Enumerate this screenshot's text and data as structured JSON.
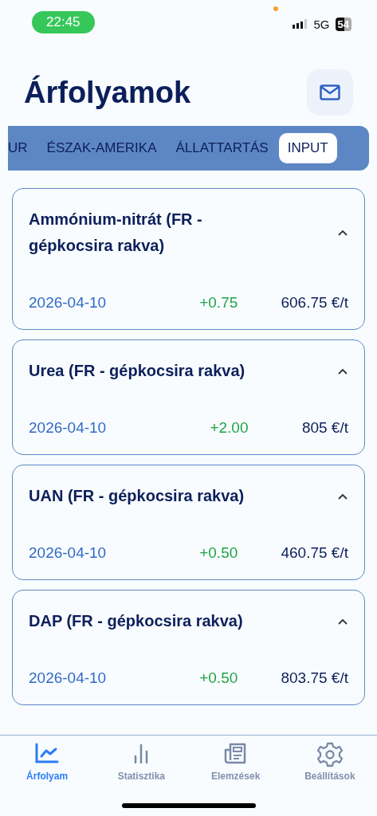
{
  "status_bar": {
    "time": "22:45",
    "network": "5G",
    "battery": "54"
  },
  "header": {
    "title": "Árfolyamok"
  },
  "tabs": [
    {
      "label": "UR",
      "selected": false
    },
    {
      "label": "ÉSZAK-AMERIKA",
      "selected": false
    },
    {
      "label": "ÁLLATTARTÁS",
      "selected": false
    },
    {
      "label": "INPUT",
      "selected": true
    }
  ],
  "prices": [
    {
      "name": "Ammónium-nitrát (FR - gépkocsira rakva)",
      "expanded": true,
      "date": "2026-04-10",
      "change": "+0.75",
      "price": "606.75 €/t"
    },
    {
      "name": "Urea (FR - gépkocsira rakva)",
      "expanded": true,
      "date": "2026-04-10",
      "change": "+2.00",
      "price": "805 €/t"
    },
    {
      "name": "UAN (FR - gépkocsira rakva)",
      "expanded": true,
      "date": "2026-04-10",
      "change": "+0.50",
      "price": "460.75 €/t"
    },
    {
      "name": "DAP (FR - gépkocsira rakva)",
      "expanded": true,
      "date": "2026-04-10",
      "change": "+0.50",
      "price": "803.75 €/t"
    }
  ],
  "bottom_nav": [
    {
      "label": "Árfolyam",
      "kind": "chart",
      "selected": true
    },
    {
      "label": "Statisztika",
      "kind": "bars",
      "selected": false
    },
    {
      "label": "Elemzések",
      "kind": "news",
      "selected": false
    },
    {
      "label": "Beállítások",
      "kind": "gear",
      "selected": false
    }
  ]
}
